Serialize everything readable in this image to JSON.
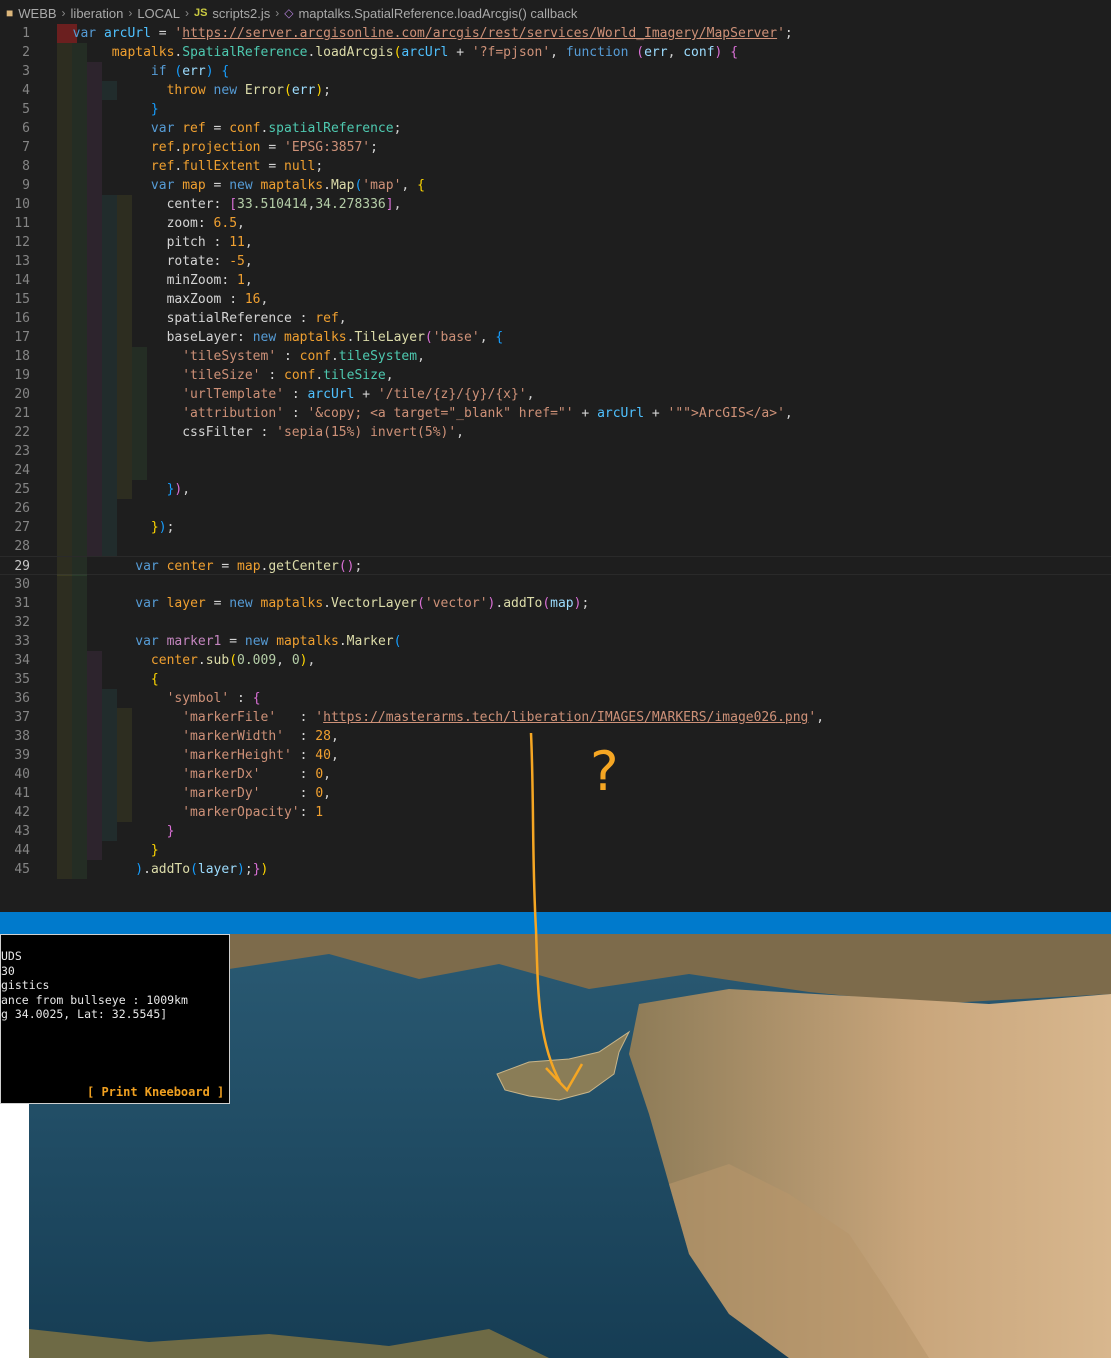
{
  "breadcrumb": {
    "items": [
      "WEBB",
      "liberation",
      "LOCAL",
      "JS",
      "scripts2.js",
      "maptalks.SpatialReference.loadArcgis() callback"
    ]
  },
  "editor": {
    "active_line": 29,
    "line_numbers": [
      "1",
      "2",
      "3",
      "4",
      "5",
      "6",
      "7",
      "8",
      "9",
      "10",
      "11",
      "12",
      "13",
      "14",
      "15",
      "16",
      "17",
      "18",
      "19",
      "20",
      "21",
      "22",
      "23",
      "24",
      "25",
      "26",
      "27",
      "28",
      "29",
      "30",
      "31",
      "32",
      "33",
      "34",
      "35",
      "36",
      "37",
      "38",
      "39",
      "40",
      "41",
      "42",
      "43",
      "44",
      "45"
    ]
  },
  "map": {
    "infobox": {
      "lines": [
        "UDS",
        "30",
        "gistics",
        "",
        "ance from bullseye : 1009km",
        "g 34.0025, Lat: 32.5545]"
      ],
      "kneeboard_label": "[ Print Kneeboard ]"
    }
  },
  "annotation": {
    "mark": "?"
  },
  "colors": {
    "editor_bg": "#1e1e1e",
    "status_bar": "#007acc",
    "annotation": "#f5a623",
    "sea": "#1f4a63",
    "land": "#c7a57d"
  }
}
